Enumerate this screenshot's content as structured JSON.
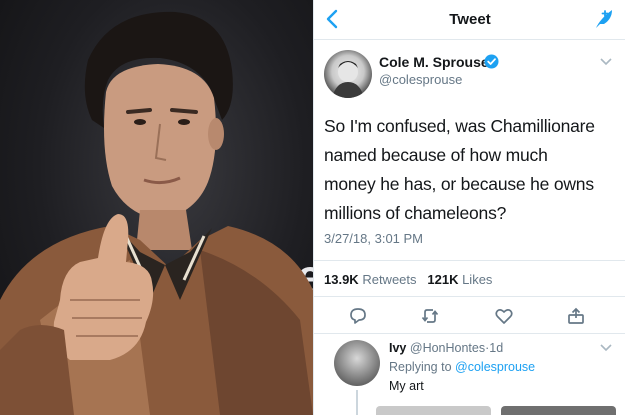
{
  "photo": {
    "backdrop_text": "Blue"
  },
  "nav": {
    "back_icon": "chevron-left-icon",
    "title": "Tweet",
    "compose_icon": "compose-feather-icon"
  },
  "tweet": {
    "author_name": "Cole M. Sprouse",
    "author_handle": "@colesprouse",
    "verified": true,
    "text_lines": [
      "So I'm confused, was Chamillionare",
      "named because of how much",
      "money he has, or because he owns",
      "millions of chameleons?"
    ],
    "timestamp": "3/27/18, 3:01 PM",
    "retweets_count": "13.9K",
    "retweets_label": "Retweets",
    "likes_count": "121K",
    "likes_label": "Likes",
    "actions": [
      "reply-icon",
      "retweet-icon",
      "like-icon",
      "share-icon"
    ]
  },
  "reply": {
    "name": "Ivy",
    "handle": "@HonHontes",
    "separator": "·",
    "age": "1d",
    "replying_to_prefix": "Replying to",
    "replying_to_handle": "@colesprouse",
    "text": "My art"
  },
  "colors": {
    "brand_blue": "#1da1f2",
    "text_primary": "#14171a",
    "text_secondary": "#657786",
    "divider": "#e1e8ed"
  }
}
